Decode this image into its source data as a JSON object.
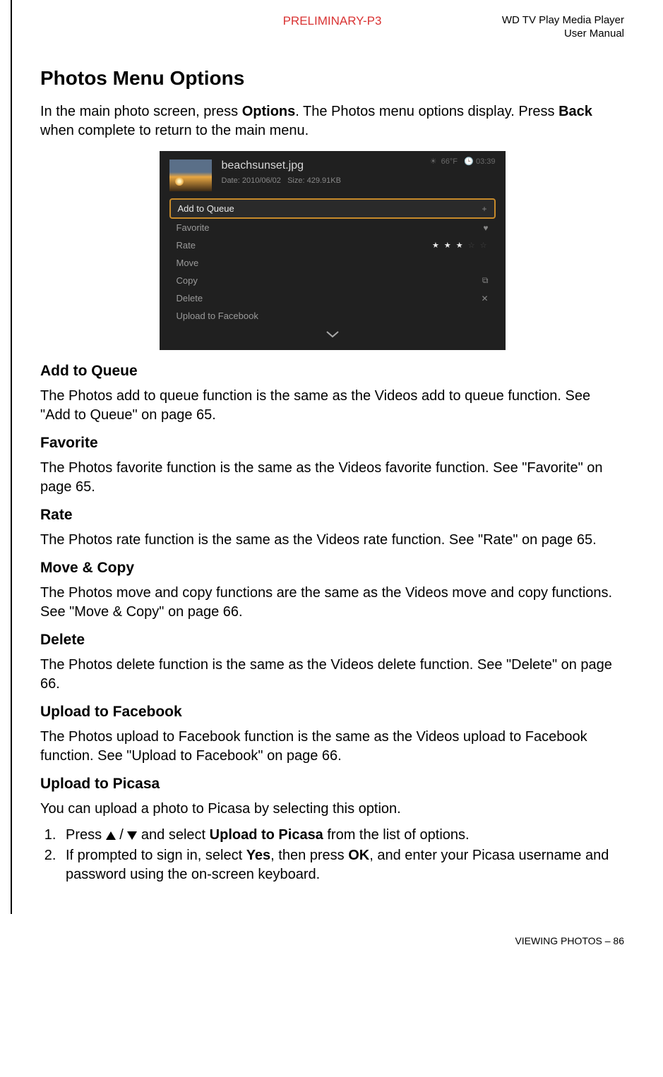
{
  "header": {
    "preliminary": "PRELIMINARY-P3",
    "title_line1": "WD TV Play Media Player",
    "title_line2": "User Manual"
  },
  "section_title": "Photos Menu Options",
  "intro": {
    "part1": "In the main photo screen, press ",
    "options": "Options",
    "part2": ". The Photos menu options display. Press ",
    "back": "Back",
    "part3": " when complete to return to the main menu."
  },
  "screenshot": {
    "filename": "beachsunset.jpg",
    "meta_date_label": "Date:",
    "meta_date": "2010/06/02",
    "meta_size_label": "Size:",
    "meta_size": "429.91KB",
    "status_temp": "66°F",
    "status_time": "03:39",
    "menu": [
      {
        "label": "Add to Queue",
        "icon": "+",
        "selected": true
      },
      {
        "label": "Favorite",
        "icon": "♥"
      },
      {
        "label": "Rate",
        "icon": "stars"
      },
      {
        "label": "Move",
        "icon": ""
      },
      {
        "label": "Copy",
        "icon": "⧉"
      },
      {
        "label": "Delete",
        "icon": "✕"
      },
      {
        "label": "Upload to Facebook",
        "icon": ""
      }
    ]
  },
  "sections": {
    "add_to_queue": {
      "heading": "Add to Queue",
      "text": "The Photos add to queue function is the same as the Videos add to queue function. See \"Add to Queue\" on page 65."
    },
    "favorite": {
      "heading": "Favorite",
      "text": "The Photos favorite function is the same as the Videos favorite function. See \"Favorite\" on page 65."
    },
    "rate": {
      "heading": "Rate",
      "text": "The Photos rate function is the same as the Videos rate function. See \"Rate\" on page 65."
    },
    "move_copy": {
      "heading": "Move & Copy",
      "text": "The Photos move and copy functions are the same as the Videos move and copy functions. See \"Move & Copy\" on page 66."
    },
    "delete": {
      "heading": "Delete",
      "text": "The Photos delete function is the same as the Videos delete function. See \"Delete\" on page 66."
    },
    "upload_fb": {
      "heading": "Upload to Facebook",
      "text": "The Photos upload to Facebook function is the same as the Videos upload to Facebook function. See \"Upload to Facebook\" on page 66."
    },
    "upload_picasa": {
      "heading": "Upload to Picasa",
      "text": "You can upload a photo to Picasa by selecting this option.",
      "step1_a": "Press ",
      "step1_b": " / ",
      "step1_c": " and select ",
      "step1_bold": "Upload to Picasa",
      "step1_d": " from the list of options.",
      "step2_a": "If prompted to sign in, select ",
      "step2_yes": "Yes",
      "step2_b": ", then press ",
      "step2_ok": "OK",
      "step2_c": ", and enter your Picasa username and password using the on-screen keyboard."
    }
  },
  "footer": {
    "text": "VIEWING PHOTOS – 86"
  }
}
